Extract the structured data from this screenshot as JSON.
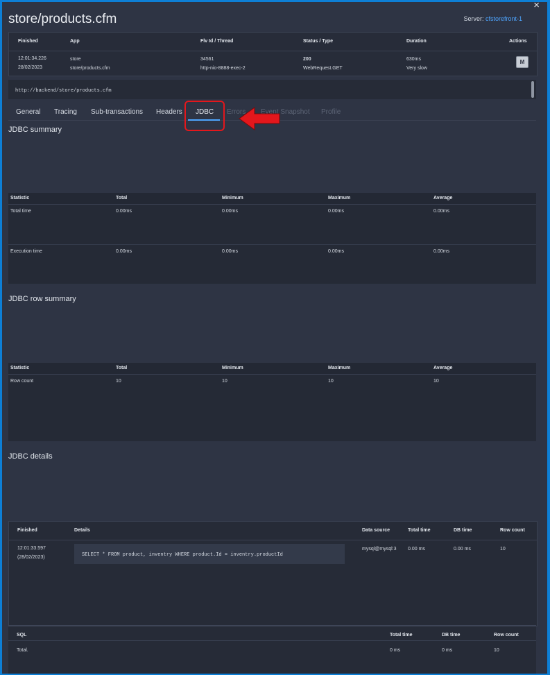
{
  "title": "store/products.cfm",
  "server": {
    "label": "Server:",
    "name": "cfstorefront-1"
  },
  "close_icon": "×",
  "summary": {
    "headers": [
      "Finished",
      "App",
      "Flv Id / Thread",
      "Status / Type",
      "Duration",
      "Actions"
    ],
    "finished_time": "12:01:34.226",
    "finished_date": "28/02/2023",
    "app_name": "store",
    "app_path": "store/products.cfm",
    "flv_id": "34561",
    "thread": "http-nio-8888-exec-2",
    "status_code": "200",
    "type": "WebRequest.GET",
    "duration": "630ms",
    "duration_note": "Very slow",
    "action_icon": "M"
  },
  "url": "http://backend/store/products.cfm",
  "tabs": [
    {
      "label": "General",
      "state": "normal"
    },
    {
      "label": "Tracing",
      "state": "normal"
    },
    {
      "label": "Sub-transactions",
      "state": "normal"
    },
    {
      "label": "Headers",
      "state": "normal"
    },
    {
      "label": "JDBC",
      "state": "active"
    },
    {
      "label": "Errors",
      "state": "disabled"
    },
    {
      "label": "Event Snapshot",
      "state": "disabled"
    },
    {
      "label": "Profile",
      "state": "disabled"
    }
  ],
  "jdbc_summary": {
    "title": "JDBC summary",
    "headers": [
      "Statistic",
      "Total",
      "Minimum",
      "Maximum",
      "Average"
    ],
    "rows": [
      [
        "Total time",
        "0.00ms",
        "0.00ms",
        "0.00ms",
        "0.00ms"
      ],
      [
        "Execution time",
        "0.00ms",
        "0.00ms",
        "0.00ms",
        "0.00ms"
      ]
    ]
  },
  "jdbc_row_summary": {
    "title": "JDBC row summary",
    "headers": [
      "Statistic",
      "Total",
      "Minimum",
      "Maximum",
      "Average"
    ],
    "rows": [
      [
        "Row count",
        "10",
        "10",
        "10",
        "10"
      ]
    ]
  },
  "jdbc_details": {
    "title": "JDBC details",
    "headers": [
      "Finished",
      "Details",
      "Data source",
      "Total time",
      "DB time",
      "Row count"
    ],
    "row": {
      "finished_time": "12:01:33.597",
      "finished_date": "(28/02/2023)",
      "sql": "SELECT * FROM product, inventry WHERE product.Id = inventry.productId",
      "data_source": "mysql@mysql:3",
      "total_time": "0.00 ms",
      "db_time": "0.00 ms",
      "row_count": "10"
    }
  },
  "totals": {
    "headers": [
      "SQL",
      "Total time",
      "DB time",
      "Row count"
    ],
    "row": [
      "Total.",
      "0 ms",
      "0 ms",
      "10"
    ]
  },
  "colors": {
    "background": "#2e3444",
    "frame": "#0d7fd6",
    "link": "#4ea5ff",
    "status_ok": "#3fd08a",
    "warning": "#f0a535",
    "highlight": "#e4171c"
  }
}
